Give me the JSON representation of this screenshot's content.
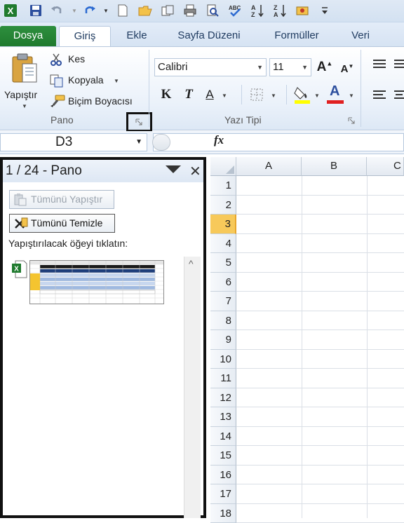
{
  "quick_access": {
    "icons": [
      "excel-icon",
      "save-icon",
      "undo-icon",
      "redo-icon",
      "new-icon",
      "open-icon",
      "send-icon",
      "print-icon",
      "print-preview-icon",
      "spelling-icon",
      "sort-asc-icon",
      "sort-desc-icon",
      "macro-icon",
      "customize-icon"
    ]
  },
  "tabs": [
    {
      "label": "Dosya"
    },
    {
      "label": "Giriş"
    },
    {
      "label": "Ekle"
    },
    {
      "label": "Sayfa Düzeni"
    },
    {
      "label": "Formüller"
    },
    {
      "label": "Veri"
    }
  ],
  "ribbon": {
    "clipboard": {
      "paste_label": "Yapıştır",
      "cut_label": "Kes",
      "copy_label": "Kopyala",
      "format_painter_label": "Biçim Boyacısı",
      "group_label": "Pano"
    },
    "font": {
      "font_name": "Calibri",
      "font_size": "11",
      "bold": "K",
      "italic": "T",
      "underline": "A",
      "font_color_letter": "A",
      "group_label": "Yazı Tipi"
    }
  },
  "formula_bar": {
    "name_box": "D3",
    "fx": "fx"
  },
  "clipboard_pane": {
    "title": "1 / 24 - Pano",
    "paste_all": "Tümünü Yapıştır",
    "clear_all": "Tümünü Temizle",
    "instruction": "Yapıştırılacak öğeyi tıklatın:"
  },
  "grid": {
    "columns": [
      "A",
      "B",
      "C"
    ],
    "rows": [
      "1",
      "2",
      "3",
      "4",
      "5",
      "6",
      "7",
      "8",
      "9",
      "10",
      "11",
      "12",
      "13",
      "14",
      "15",
      "16",
      "17",
      "18"
    ],
    "selected_row": "3"
  },
  "colors": {
    "file_tab": "#1f7a2e",
    "selected_row_header": "#f7c95a",
    "fill_color_bar": "#ffff00",
    "font_color_bar": "#e02020"
  }
}
